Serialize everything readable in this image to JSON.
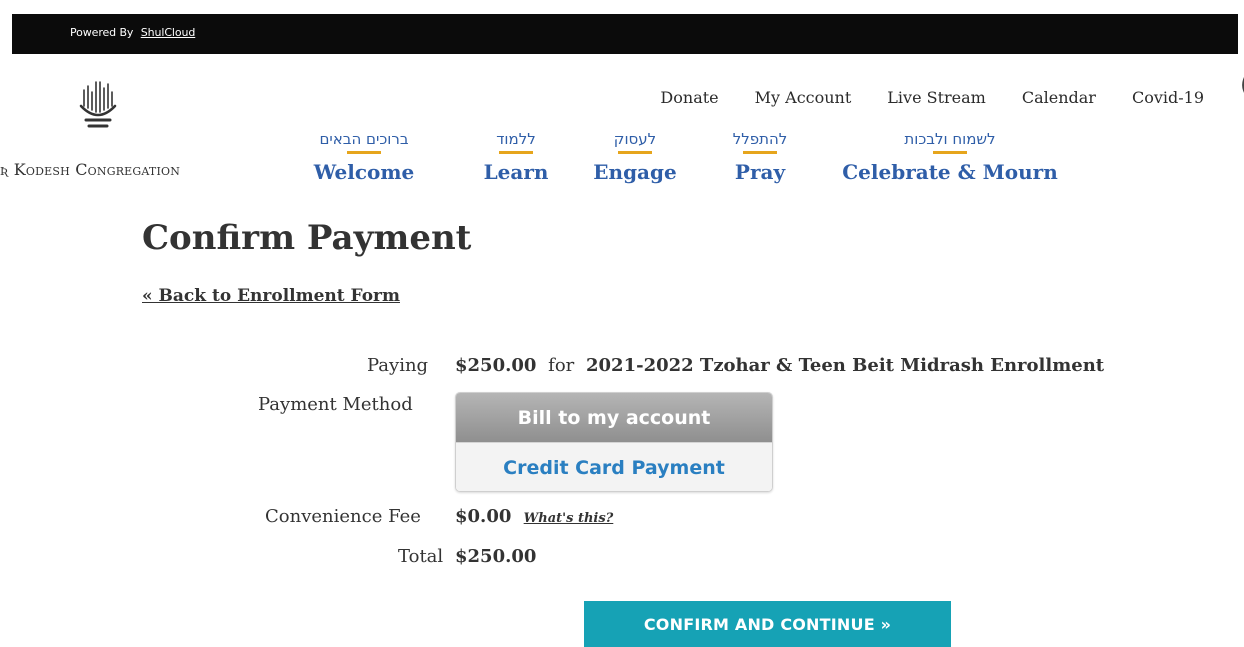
{
  "topbar": {
    "powered_by": "Powered By",
    "brand_link": "ShulCloud"
  },
  "logo": {
    "text": "Kodesh Congregation"
  },
  "utility_nav": [
    {
      "label": "Donate"
    },
    {
      "label": "My Account"
    },
    {
      "label": "Live Stream"
    },
    {
      "label": "Calendar"
    },
    {
      "label": "Covid-19"
    }
  ],
  "main_nav": [
    {
      "hebrew": "ברוכים הבאים",
      "label": "Welcome"
    },
    {
      "hebrew": "ללמוד",
      "label": "Learn"
    },
    {
      "hebrew": "לעסוק",
      "label": "Engage"
    },
    {
      "hebrew": "להתפלל",
      "label": "Pray"
    },
    {
      "hebrew": "לשמוח ולבכות",
      "label": "Celebrate & Mourn"
    }
  ],
  "page": {
    "title": "Confirm Payment",
    "back_link": "« Back to Enrollment Form"
  },
  "payment": {
    "paying_label": "Paying",
    "amount": "$250.00",
    "for_text": "for",
    "item": "2021-2022 Tzohar & Teen Beit Midrash Enrollment",
    "method_label": "Payment Method",
    "methods": [
      {
        "label": "Bill to my account",
        "selected": true
      },
      {
        "label": "Credit Card Payment",
        "selected": false
      }
    ],
    "fee_label": "Convenience Fee",
    "fee_value": "$0.00",
    "fee_help": "What's this?",
    "total_label": "Total",
    "total_value": "$250.00",
    "confirm_button": "CONFIRM AND CONTINUE »"
  },
  "colors": {
    "nav_blue": "#2f5ea8",
    "nav_underline": "#e6a51c",
    "confirm_teal": "#16a2b5",
    "link_blue": "#2a7fc1"
  }
}
